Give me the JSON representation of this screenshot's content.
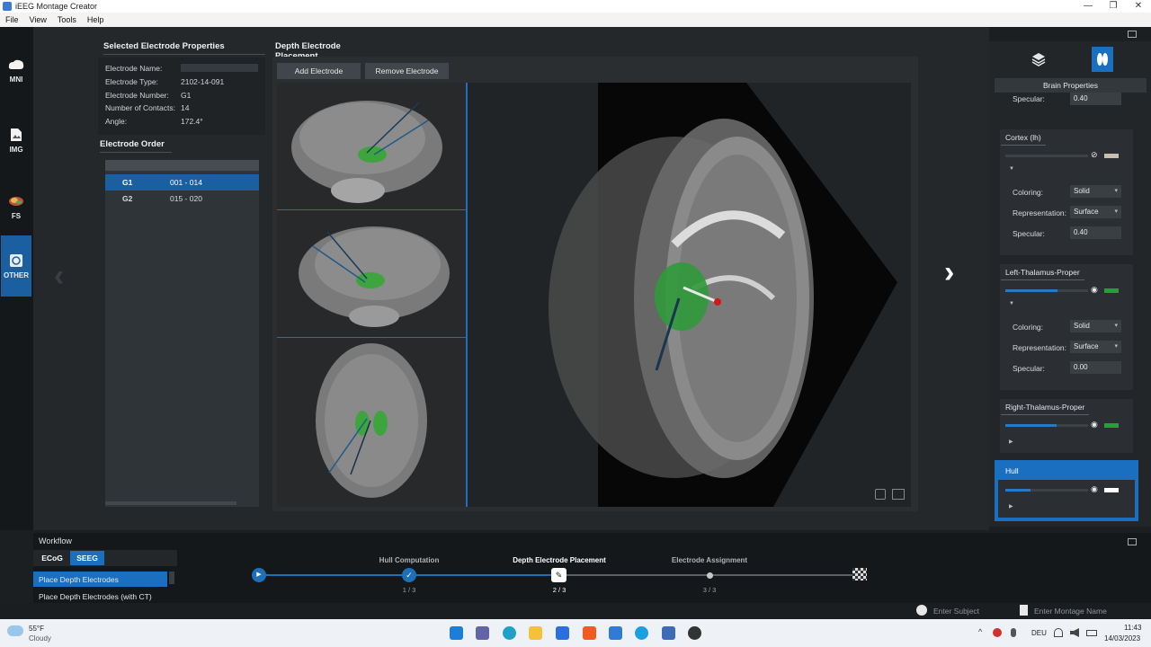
{
  "window": {
    "title": "iEEG Montage Creator",
    "controls": [
      "—",
      "❐",
      "✕"
    ]
  },
  "menu": [
    "File",
    "View",
    "Tools",
    "Help"
  ],
  "sidebar": [
    {
      "label": "MNI",
      "icon": "cloud-brain-icon"
    },
    {
      "label": "IMG",
      "icon": "image-file-icon"
    },
    {
      "label": "FS",
      "icon": "brain-color-icon"
    },
    {
      "label": "OTHER",
      "icon": "other-icon",
      "active": true
    }
  ],
  "properties": {
    "title": "Selected Electrode Properties",
    "rows": [
      {
        "label": "Electrode Name:",
        "value": ""
      },
      {
        "label": "Electrode Type:",
        "value": "2102-14-091"
      },
      {
        "label": "Electrode Number:",
        "value": "G1"
      },
      {
        "label": "Number of Contacts:",
        "value": "14"
      },
      {
        "label": "Angle:",
        "value": "172.4°"
      }
    ]
  },
  "order": {
    "title": "Electrode Order",
    "rows": [
      {
        "name": "G1",
        "range": "001 - 014",
        "selected": true
      },
      {
        "name": "G2",
        "range": "015 - 020",
        "selected": false
      }
    ]
  },
  "placement": {
    "title": "Depth Electrode Placement",
    "add_label": "Add Electrode",
    "remove_label": "Remove Electrode"
  },
  "brain_properties": {
    "header": "Brain Properties",
    "top_specular_label": "Specular:",
    "top_specular_value": "0.40",
    "sections": [
      {
        "title": "Cortex (lh)",
        "coloring_label": "Coloring:",
        "coloring": "Solid",
        "representation_label": "Representation:",
        "representation": "Surface",
        "specular_label": "Specular:",
        "specular": "0.40",
        "opacity": 0.0,
        "color": "#c8bfb0",
        "visible": false
      },
      {
        "title": "Left-Thalamus-Proper",
        "coloring_label": "Coloring:",
        "coloring": "Solid",
        "representation_label": "Representation:",
        "representation": "Surface",
        "specular_label": "Specular:",
        "specular": "0.00",
        "opacity": 0.85,
        "color": "#22a03c",
        "visible": true
      },
      {
        "title": "Right-Thalamus-Proper",
        "opacity": 0.85,
        "color": "#22a03c",
        "visible": true
      },
      {
        "title": "Hull",
        "opacity": 0.3,
        "color": "#ffffff",
        "visible": true,
        "active": true
      }
    ]
  },
  "workflow": {
    "label": "Workflow",
    "tabs": [
      {
        "label": "ECoG",
        "active": false
      },
      {
        "label": "SEEG",
        "active": true
      }
    ],
    "items": [
      {
        "label": "Place Depth Electrodes",
        "selected": true
      },
      {
        "label": "Place Depth Electrodes (with CT)",
        "selected": false
      }
    ],
    "steps": [
      {
        "label": "",
        "count": ""
      },
      {
        "label": "Hull Computation",
        "count": "1 / 3"
      },
      {
        "label": "Depth Electrode Placement",
        "count": "2 / 3"
      },
      {
        "label": "Electrode Assignment",
        "count": "3 / 3"
      }
    ]
  },
  "bottom": {
    "subject_placeholder": "Enter Subject",
    "montage_placeholder": "Enter Montage Name"
  },
  "taskbar": {
    "weather_temp": "55°F",
    "weather_desc": "Cloudy",
    "lang": "DEU",
    "time": "11:43",
    "date": "14/03/2023"
  }
}
